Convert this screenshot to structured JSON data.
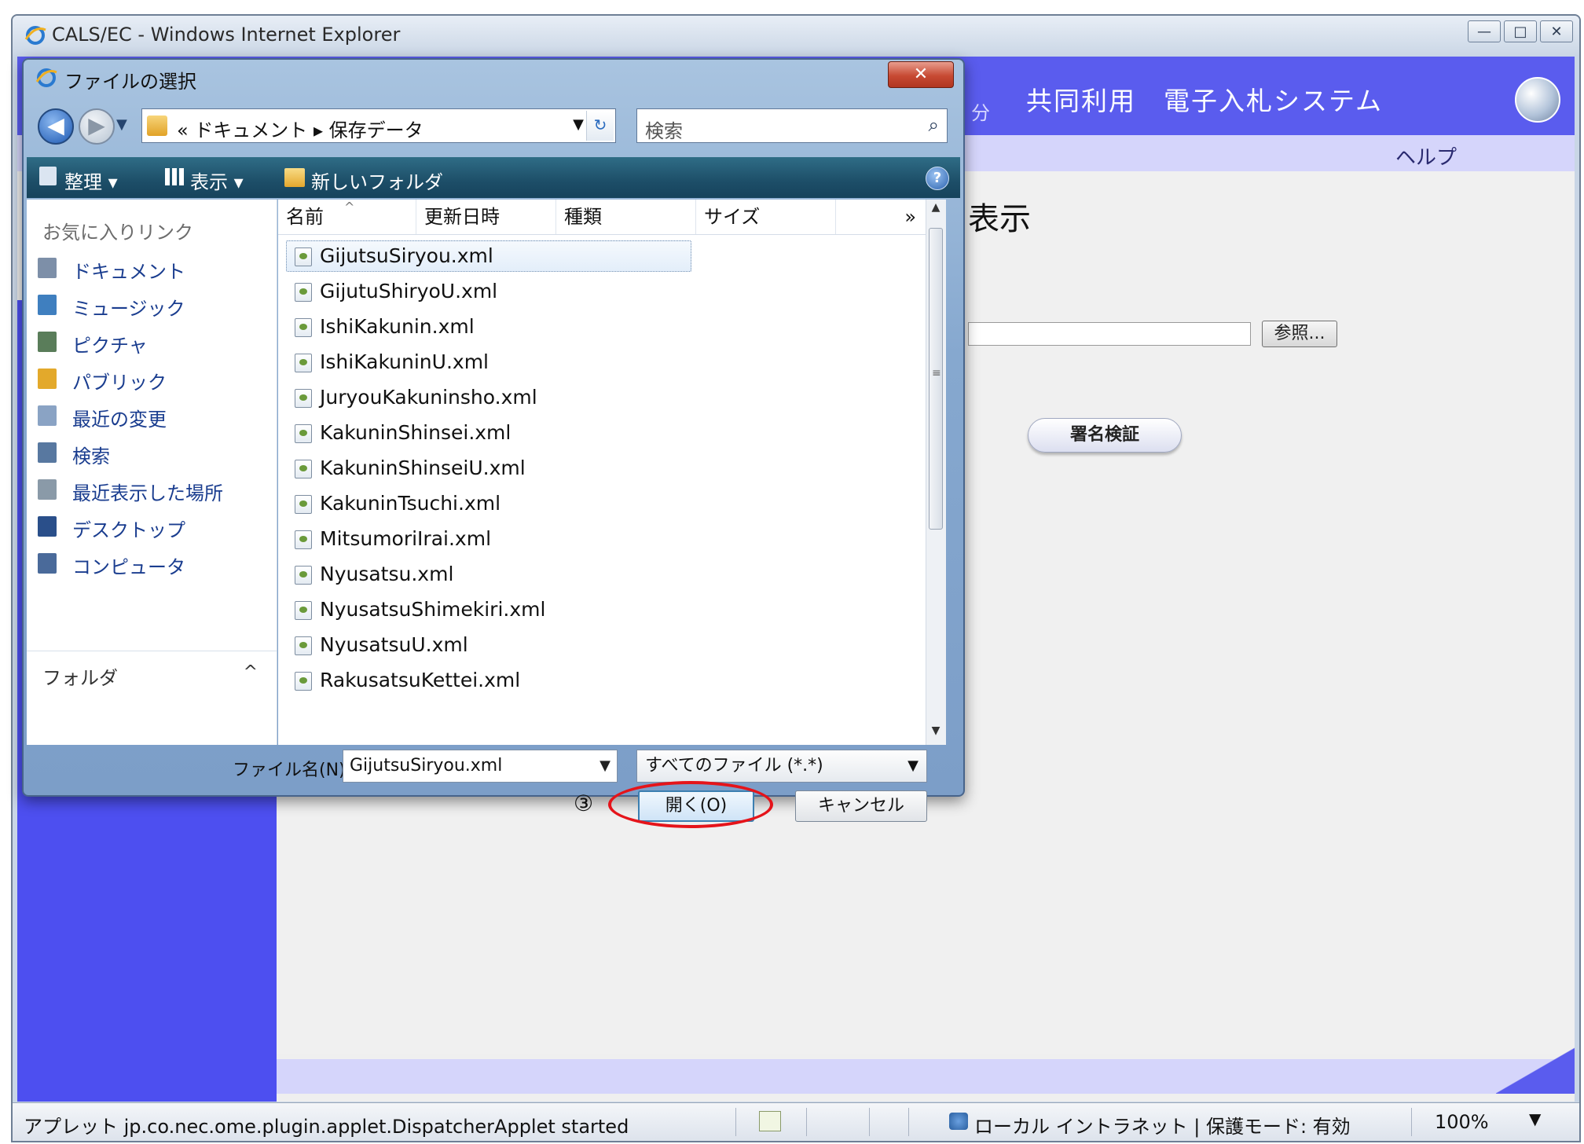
{
  "browser": {
    "window_title": "CALS/EC - Windows Internet Explorer",
    "controls": {
      "minimize": "—",
      "maximize": "□",
      "close": "✕"
    }
  },
  "page": {
    "header_partial": "分",
    "header_title": "共同利用　電子入札システム",
    "help_link": "ヘルプ",
    "heading_partial": "表示",
    "browse_button": "参照...",
    "verify_button": "署名検証"
  },
  "status_bar": {
    "text": "アプレット jp.co.nec.ome.plugin.applet.DispatcherApplet started",
    "zone": "ローカル イントラネット | 保護モード: 有効",
    "zoom": "100%",
    "zoom_arrow": "▼"
  },
  "dialog": {
    "title": "ファイルの選択",
    "close_glyph": "✕",
    "back_glyph": "◀",
    "forward_glyph": "▶",
    "history_glyph": "▼",
    "address_path": "« ドキュメント ▸ 保存データ",
    "address_dropdown": "▼",
    "refresh_glyph": "↻",
    "search_placeholder": "検索",
    "search_glyph": "⌕",
    "toolbar": {
      "organize": "整理 ▾",
      "views": "表示 ▾",
      "new_folder": "新しいフォルダ",
      "help_glyph": "?"
    },
    "nav_pane": {
      "heading": "お気に入りリンク",
      "items": [
        {
          "label": "ドキュメント",
          "color": "#7d8fa8"
        },
        {
          "label": "ミュージック",
          "color": "#3f7fbf"
        },
        {
          "label": "ピクチャ",
          "color": "#5a7d5a"
        },
        {
          "label": "パブリック",
          "color": "#e3a92b"
        },
        {
          "label": "最近の変更",
          "color": "#8aa3c4"
        },
        {
          "label": "検索",
          "color": "#5878a0"
        },
        {
          "label": "最近表示した場所",
          "color": "#8a9aa8"
        },
        {
          "label": "デスクトップ",
          "color": "#2a4f8a"
        },
        {
          "label": "コンピュータ",
          "color": "#4a6a9a"
        }
      ],
      "folder_label": "フォルダ",
      "folder_toggle": "^"
    },
    "columns": [
      "名前",
      "更新日時",
      "種類",
      "サイズ"
    ],
    "column_more": "»",
    "sort_glyph": "^",
    "files": [
      "GijutsuSiryou.xml",
      "GijutuShiryoU.xml",
      "IshiKakunin.xml",
      "IshiKakuninU.xml",
      "JuryouKakuninsho.xml",
      "KakuninShinsei.xml",
      "KakuninShinseiU.xml",
      "KakuninTsuchi.xml",
      "MitsumoriIrai.xml",
      "Nyusatsu.xml",
      "NyusatsuShimekiri.xml",
      "NyusatsuU.xml",
      "RakusatsuKettei.xml"
    ],
    "selected_index": 0,
    "scroll": {
      "up": "▲",
      "down": "▼",
      "grip": "≡"
    },
    "filename_label": "ファイル名(N):",
    "filename_value": "GijutsuSiryou.xml",
    "filename_dropdown": "▼",
    "filetype_value": "すべてのファイル (*.*)",
    "filetype_dropdown": "▼",
    "step_marker": "③",
    "open_button": "開く(O)",
    "cancel_button": "キャンセル",
    "highlight_color": "#e5141a"
  }
}
